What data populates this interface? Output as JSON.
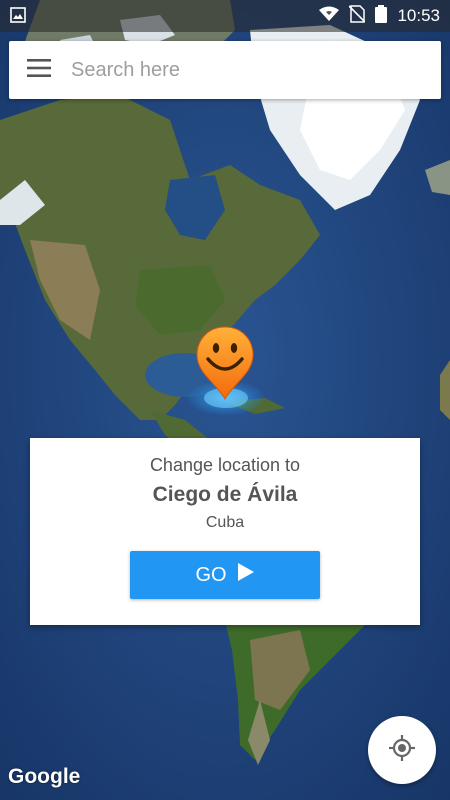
{
  "status_bar": {
    "time": "10:53",
    "icons": [
      "image-icon",
      "wifi-icon",
      "no-sim-icon",
      "battery-icon"
    ]
  },
  "search": {
    "placeholder": "Search here",
    "menu_icon": "menu-icon"
  },
  "map": {
    "pin_icon": "smiley-pin-icon",
    "colors": {
      "ocean": "#1e3f78",
      "land": "#5a6b3a",
      "ice": "#e8eef2"
    }
  },
  "location_card": {
    "caption": "Change location to",
    "city": "Ciego de Ávila",
    "country": "Cuba",
    "go_label": "GO",
    "go_icon": "play-icon",
    "accent_color": "#2196f3"
  },
  "footer": {
    "logo_text": "Google",
    "locate_icon": "my-location-icon"
  }
}
